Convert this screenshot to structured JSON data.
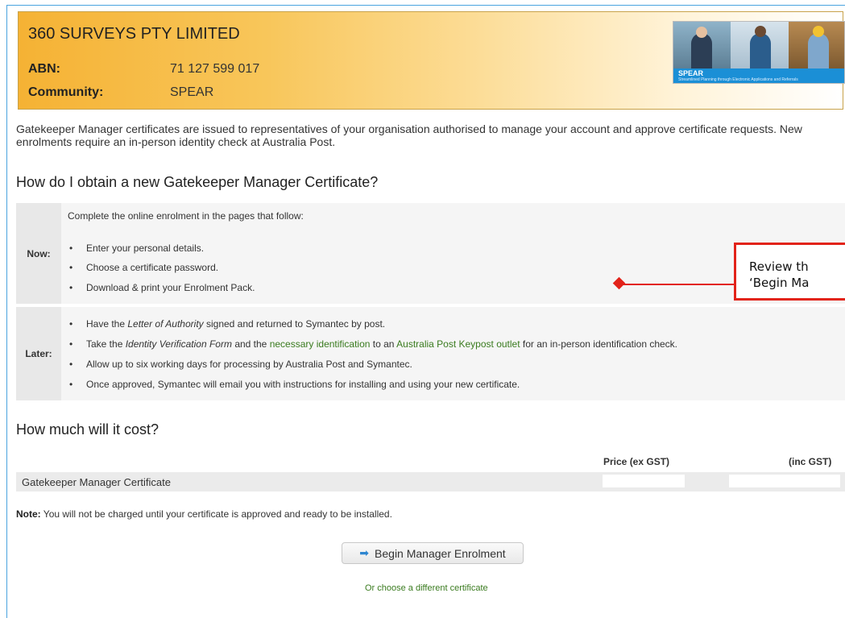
{
  "banner": {
    "org_name": "360 SURVEYS PTY LIMITED",
    "abn_label": "ABN:",
    "abn_value": "71 127 599 017",
    "community_label": "Community:",
    "community_value": "SPEAR",
    "logo": {
      "title": "SPEAR",
      "subtitle": "Streamlined Planning through Electronic Applications and Referrals"
    },
    "colors": {
      "gradient_start": "#f5b234",
      "gradient_end": "#ffffff"
    }
  },
  "intro": "Gatekeeper Manager certificates are issued to representatives of your organisation authorised to manage your account and approve certificate requests. New enrolments require an in-person identity check at Australia Post.",
  "obtain": {
    "heading": "How do I obtain a new Gatekeeper Manager Certificate?",
    "now": {
      "label": "Now:",
      "intro": "Complete the online enrolment in the pages that follow:",
      "items": [
        "Enter your personal details.",
        "Choose a certificate password.",
        "Download & print your Enrolment Pack."
      ]
    },
    "later": {
      "label": "Later:",
      "item1": {
        "a": "Have the ",
        "b": "Letter of Authority",
        "c": " signed and returned to Symantec by post."
      },
      "item2": {
        "a": "Take the ",
        "b": "Identity Verification Form",
        "c": " and the ",
        "d": "necessary identification",
        "e": " to an ",
        "f": "Australia Post Keypost outlet",
        "g": " for an in-person identification check."
      },
      "item3": "Allow up to six working days for processing by Australia Post and Symantec.",
      "item4": "Once approved, Symantec will email you with instructions for installing and using your new certificate."
    }
  },
  "cost": {
    "heading": "How much will it cost?",
    "col_ex": "Price (ex GST)",
    "col_inc": "(inc GST)",
    "row_name": "Gatekeeper Manager Certificate",
    "note_label": "Note:",
    "note_text": " You will not be charged until your certificate is approved and ready to be installed."
  },
  "actions": {
    "begin_label": "Begin Manager Enrolment",
    "alt_link": "Or choose a different certificate"
  },
  "callout": {
    "line1": "Review th",
    "line2": "‘Begin Ma",
    "color": "#e2231a"
  },
  "colors": {
    "link": "#3a7b1f",
    "frame": "#4aa3df"
  },
  "icons": {
    "begin": "arrow-right-icon"
  }
}
